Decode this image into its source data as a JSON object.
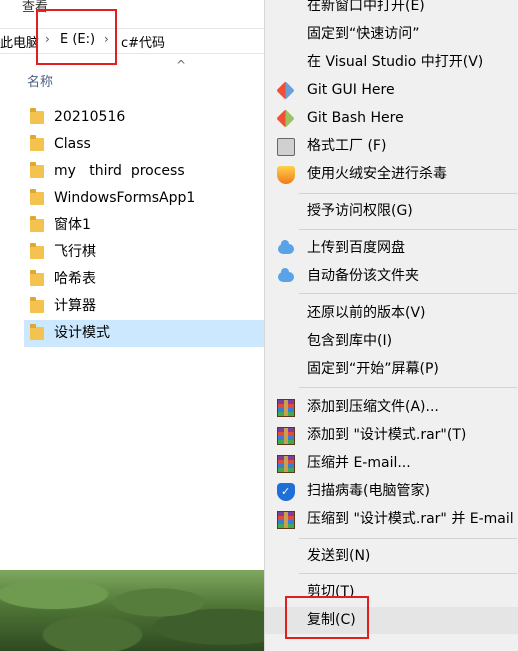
{
  "explorer": {
    "menu_label": "查看",
    "breadcrumb": [
      "此电脑",
      "E (E:)",
      "c#代码"
    ],
    "column_header": "名称",
    "files": [
      {
        "name": "20210516",
        "selected": false
      },
      {
        "name": "Class",
        "selected": false
      },
      {
        "name": "my   third  process",
        "selected": false
      },
      {
        "name": "WindowsFormsApp1",
        "selected": false
      },
      {
        "name": "窗体1",
        "selected": false
      },
      {
        "name": "飞行棋",
        "selected": false
      },
      {
        "name": "哈希表",
        "selected": false
      },
      {
        "name": "计算器",
        "selected": false
      },
      {
        "name": "设计模式",
        "selected": true
      }
    ]
  },
  "context_menu": {
    "items": [
      {
        "label": "在新窗口中打开(E)",
        "icon": null
      },
      {
        "label": "固定到“快速访问”",
        "icon": null
      },
      {
        "label": "在 Visual Studio 中打开(V)",
        "icon": null
      },
      {
        "label": "Git GUI Here",
        "icon": "git-gui-icon"
      },
      {
        "label": "Git Bash Here",
        "icon": "git-bash-icon"
      },
      {
        "label": "格式工厂 (F)",
        "icon": "format-factory-icon"
      },
      {
        "label": "使用火绒安全进行杀毒",
        "icon": "huorong-icon"
      },
      {
        "label": "授予访问权限(G)",
        "icon": null
      },
      {
        "label": "上传到百度网盘",
        "icon": "baidu-cloud-icon"
      },
      {
        "label": "自动备份该文件夹",
        "icon": "baidu-cloud-icon"
      },
      {
        "label": "还原以前的版本(V)",
        "icon": null
      },
      {
        "label": "包含到库中(I)",
        "icon": null
      },
      {
        "label": "固定到“开始”屏幕(P)",
        "icon": null
      },
      {
        "label": "添加到压缩文件(A)...",
        "icon": "winrar-icon"
      },
      {
        "label": "添加到 \"设计模式.rar\"(T)",
        "icon": "winrar-icon"
      },
      {
        "label": "压缩并 E-mail...",
        "icon": "winrar-icon"
      },
      {
        "label": "扫描病毒(电脑管家)",
        "icon": "tencent-shield-icon"
      },
      {
        "label": "压缩到 \"设计模式.rar\" 并 E-mail",
        "icon": "winrar-icon"
      },
      {
        "label": "发送到(N)",
        "icon": null
      },
      {
        "label": "剪切(T)",
        "icon": null
      },
      {
        "label": "复制(C)",
        "icon": null
      }
    ]
  }
}
